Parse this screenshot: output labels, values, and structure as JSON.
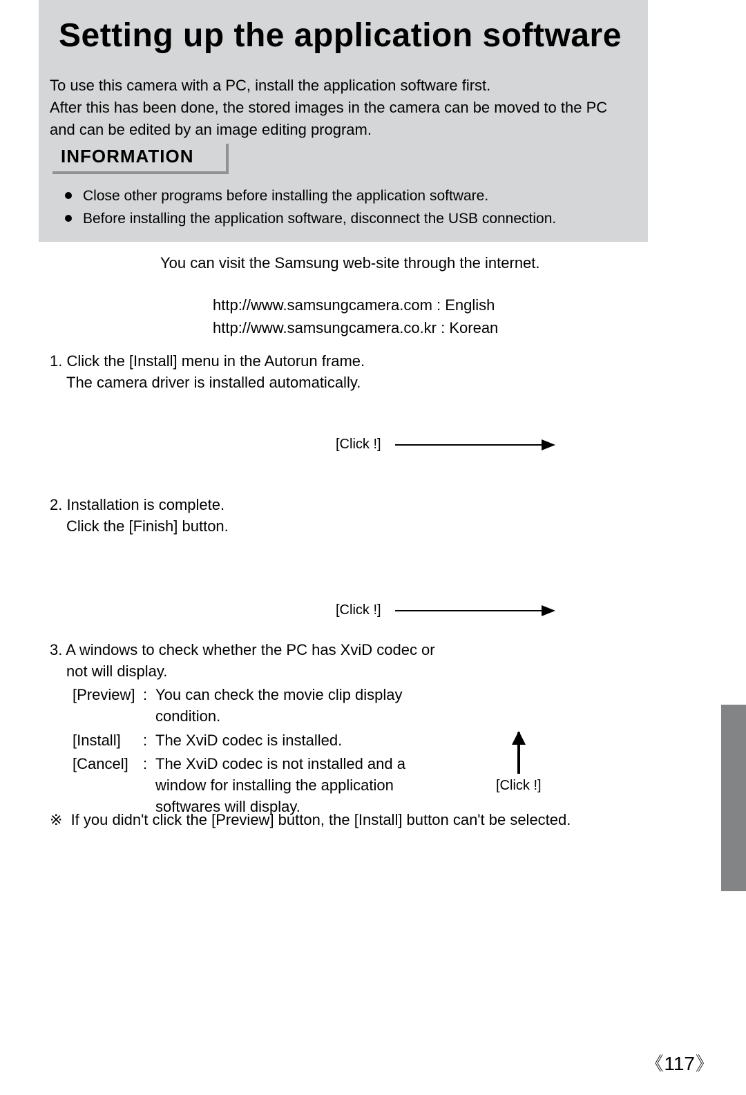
{
  "title": "Setting up the application software",
  "intro_line1": "To use this camera with a PC, install the application software first.",
  "intro_line2": "After this has been done, the stored images in the camera can be moved to the PC and can be edited by an image editing program.",
  "info_heading": "INFORMATION",
  "info_items": [
    "Close other programs before installing the application software.",
    "Before installing the application software, disconnect the USB connection."
  ],
  "visit_text": "You can visit the Samsung web-site through the internet.",
  "url_en": "http://www.samsungcamera.com : English",
  "url_kr": "http://www.samsungcamera.co.kr : Korean",
  "step1_l1": "1. Click the [Install] menu in the Autorun frame.",
  "step1_l2": "The camera driver is installed automatically.",
  "click_label": "[Click !]",
  "step2_l1": "2. Installation is complete.",
  "step2_l2": "Click the [Finish] button.",
  "step3_l1": "3. A windows to check whether the PC has XviD codec or",
  "step3_l2": "not will display.",
  "options": [
    {
      "label": "[Preview]",
      "desc": "You can check the movie clip display condition."
    },
    {
      "label": "[Install]",
      "desc": "The XviD codec is installed."
    },
    {
      "label": "[Cancel]",
      "desc": "The XviD codec is not installed and a window for installing the application softwares will display."
    }
  ],
  "note_symbol": "※",
  "note_text": "If you didn't click the [Preview] button, the [Install] button can't be selected.",
  "page_number": "117",
  "page_bracket_l": "《",
  "page_bracket_r": "》"
}
